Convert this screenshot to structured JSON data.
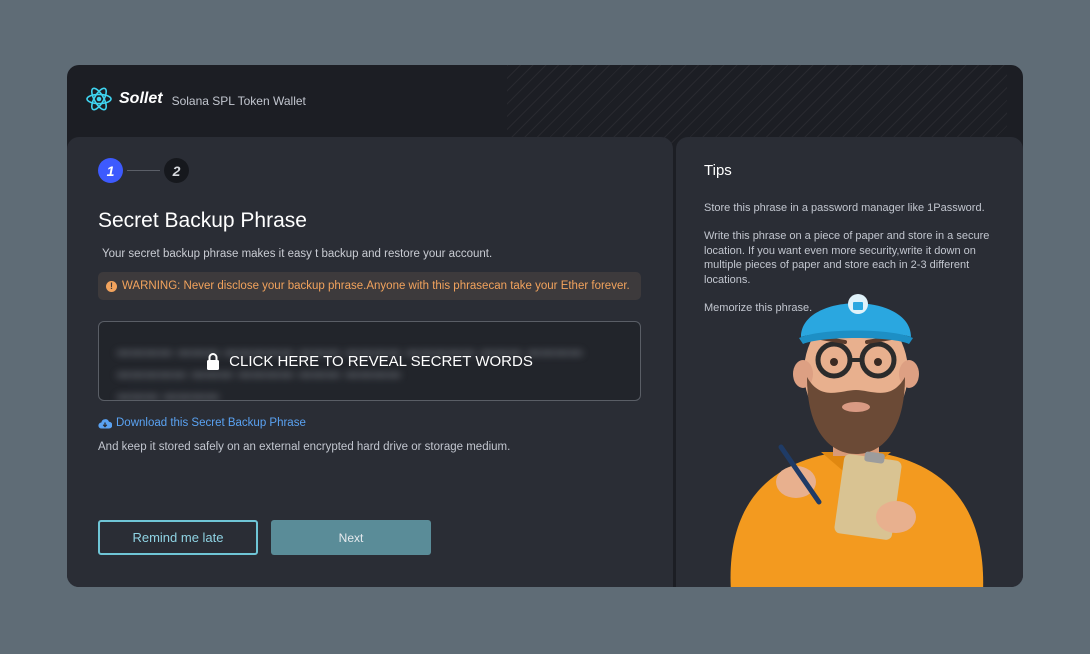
{
  "brand": {
    "name": "Sollet",
    "subtitle": "Solana SPL Token Wallet"
  },
  "stepper": {
    "steps": [
      "1",
      "2"
    ],
    "active": 1
  },
  "main": {
    "title": "Secret Backup Phrase",
    "subtitle": "Your secret backup phrase makes it easy t backup and restore your account.",
    "warning": "WARNING: Never disclose your backup phrase.Anyone with this phrasecan take your Ether forever.",
    "reveal_label": "CLICK HERE TO REVEAL SECRET WORDS",
    "download_link": "Download this Secret Backup Phrase",
    "note": "And keep it stored safely on an external encrypted hard drive or storage medium.",
    "remind_label": "Remind me late",
    "next_label": "Next"
  },
  "tips": {
    "title": "Tips",
    "items": [
      "Store this phrase in a password manager like 1Password.",
      "Write this phrase on a piece of paper and store in a secure location. If you want even more security,write it down on multiple pieces of paper and store each in 2-3 different locations.",
      "Memorize this phrase."
    ]
  },
  "icons": {
    "logo": "atom-logo-icon",
    "warning": "exclamation-circle-icon",
    "lock": "lock-icon",
    "download": "cloud-download-icon"
  },
  "colors": {
    "accent": "#3d5afe",
    "warning": "#f2a35d",
    "link": "#5aa2f2",
    "secondary_button_border": "#6fc5d6",
    "primary_button": "#5a8c98"
  }
}
